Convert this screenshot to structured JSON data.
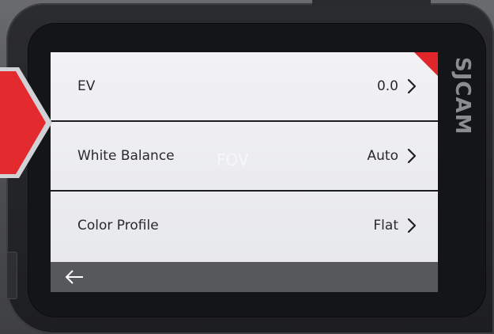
{
  "brand": {
    "logo_text": "SJCAM"
  },
  "menu": {
    "items": [
      {
        "label": "EV",
        "value": "0.0"
      },
      {
        "label": "White Balance",
        "value": "Auto"
      },
      {
        "label": "Color Profile",
        "value": "Flat"
      }
    ],
    "ghost_text": "FOV"
  },
  "icons": {
    "row_chevron": "chevron-right-icon",
    "back": "arrow-left-icon",
    "side_pointer": "pointer-arrow-icon"
  },
  "colors": {
    "accent": "#e0262b",
    "screen_bg": "#eeeff1",
    "bottom_bar": "#57585c",
    "body": "#1d1e20",
    "text": "#2a2a2c"
  }
}
